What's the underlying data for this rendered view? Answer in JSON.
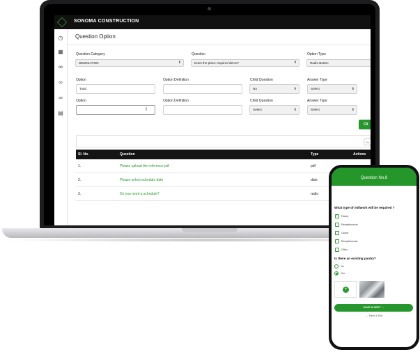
{
  "app": {
    "brand": "SONOMA CONSTRUCTION",
    "page_title": "Question Option",
    "sidebar_icons": [
      "dashboard-icon",
      "building-icon",
      "users-icon",
      "link-icon",
      "link-icon",
      "document-icon"
    ]
  },
  "form": {
    "question_category": {
      "label": "Question Category",
      "value": "DEMOLITION"
    },
    "question": {
      "label": "Question",
      "value": "Does the place required demo?"
    },
    "option_type": {
      "label": "Option Type",
      "value": "Radio Button"
    },
    "rows": [
      {
        "option_label": "Option",
        "option_value": "Total",
        "definition_label": "Option Definition",
        "definition_value": "",
        "child_label": "Child Question",
        "child_value": "No",
        "answer_label": "Answer Type",
        "answer_value": "Select"
      },
      {
        "option_label": "Option",
        "option_value": "",
        "definition_label": "Option Definition",
        "definition_value": "",
        "child_label": "Child Question",
        "child_value": "Select",
        "answer_label": "Answer Type",
        "answer_value": "Select"
      }
    ],
    "button_label": "Cli",
    "search_placeholder": "Se"
  },
  "table": {
    "headers": [
      "Sl. No.",
      "Question",
      "Type",
      "Actions"
    ],
    "rows": [
      {
        "no": "1.",
        "question": "Please upload the reference pdf",
        "type": "pdf"
      },
      {
        "no": "2.",
        "question": "Please select schedule date",
        "type": "date"
      },
      {
        "no": "3.",
        "question": "Do you need a schedule?",
        "type": "radio"
      }
    ]
  },
  "phone": {
    "header": "Question No.8",
    "q1": "What type of millwork will be required ?",
    "q1_options": [
      {
        "label": "Pantry",
        "checked": true
      },
      {
        "label": "Receptionwork",
        "checked": false
      },
      {
        "label": "Closet",
        "checked": false
      },
      {
        "label": "Receptionroad",
        "checked": false
      },
      {
        "label": "Other",
        "checked": false
      }
    ],
    "q2": "Is there an existing pantry?",
    "q2_options": [
      {
        "label": "No",
        "selected": false
      },
      {
        "label": "Yes",
        "selected": true
      }
    ],
    "add_icon": "+",
    "save_next": "SAVE & NEXT →",
    "save_exit": "←  Save & Exit",
    "accent": "#27962c"
  }
}
